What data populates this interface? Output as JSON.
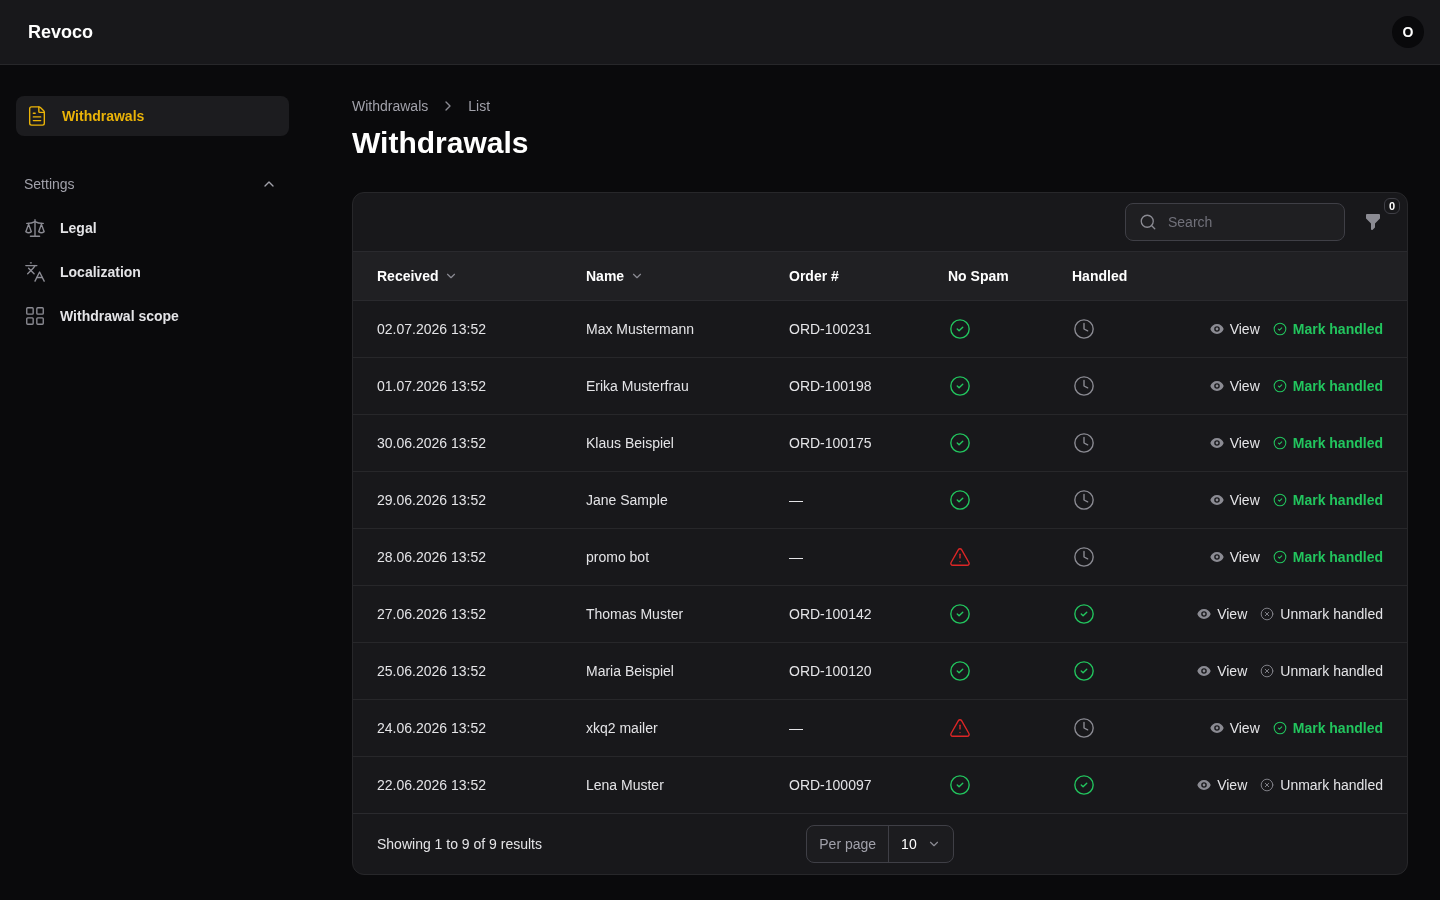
{
  "header": {
    "brand": "Revoco",
    "avatar": "O"
  },
  "sidebar": {
    "items": [
      {
        "label": "Withdrawals",
        "selected": true
      }
    ],
    "groups": [
      {
        "label": "Settings",
        "expanded": true,
        "items": [
          {
            "label": "Legal",
            "selected": false
          },
          {
            "label": "Localization",
            "selected": false
          },
          {
            "label": "Withdrawal scope",
            "selected": false
          }
        ]
      }
    ]
  },
  "breadcrumbs": [
    "Withdrawals",
    "List"
  ],
  "title": "Withdrawals",
  "table": {
    "search": {
      "placeholder": "Search"
    },
    "filter_count": "0",
    "columns": [
      {
        "label": "Received",
        "sortable": true
      },
      {
        "label": "Name",
        "sortable": true
      },
      {
        "label": "Order #",
        "sortable": false
      },
      {
        "label": "No Spam",
        "sortable": false
      },
      {
        "label": "Handled",
        "sortable": false
      }
    ],
    "rows": [
      {
        "received": "02.07.2026 13:52",
        "name": "Max Mustermann",
        "order": "ORD-100231",
        "no_spam": true,
        "handled": false,
        "view": "View",
        "action": "Mark handled"
      },
      {
        "received": "01.07.2026 13:52",
        "name": "Erika Musterfrau",
        "order": "ORD-100198",
        "no_spam": true,
        "handled": false,
        "view": "View",
        "action": "Mark handled"
      },
      {
        "received": "30.06.2026 13:52",
        "name": "Klaus Beispiel",
        "order": "ORD-100175",
        "no_spam": true,
        "handled": false,
        "view": "View",
        "action": "Mark handled"
      },
      {
        "received": "29.06.2026 13:52",
        "name": "Jane Sample",
        "order": "—",
        "no_spam": true,
        "handled": false,
        "view": "View",
        "action": "Mark handled"
      },
      {
        "received": "28.06.2026 13:52",
        "name": "promo bot",
        "order": "—",
        "no_spam": false,
        "handled": false,
        "view": "View",
        "action": "Mark handled"
      },
      {
        "received": "27.06.2026 13:52",
        "name": "Thomas Muster",
        "order": "ORD-100142",
        "no_spam": true,
        "handled": true,
        "view": "View",
        "action": "Unmark handled"
      },
      {
        "received": "25.06.2026 13:52",
        "name": "Maria Beispiel",
        "order": "ORD-100120",
        "no_spam": true,
        "handled": true,
        "view": "View",
        "action": "Unmark handled"
      },
      {
        "received": "24.06.2026 13:52",
        "name": "xkq2 mailer",
        "order": "—",
        "no_spam": false,
        "handled": false,
        "view": "View",
        "action": "Mark handled"
      },
      {
        "received": "22.06.2026 13:52",
        "name": "Lena Muster",
        "order": "ORD-100097",
        "no_spam": true,
        "handled": true,
        "view": "View",
        "action": "Unmark handled"
      }
    ],
    "footer": {
      "summary": "Showing 1 to 9 of 9 results",
      "per_page_label": "Per page",
      "per_page": "10"
    }
  }
}
